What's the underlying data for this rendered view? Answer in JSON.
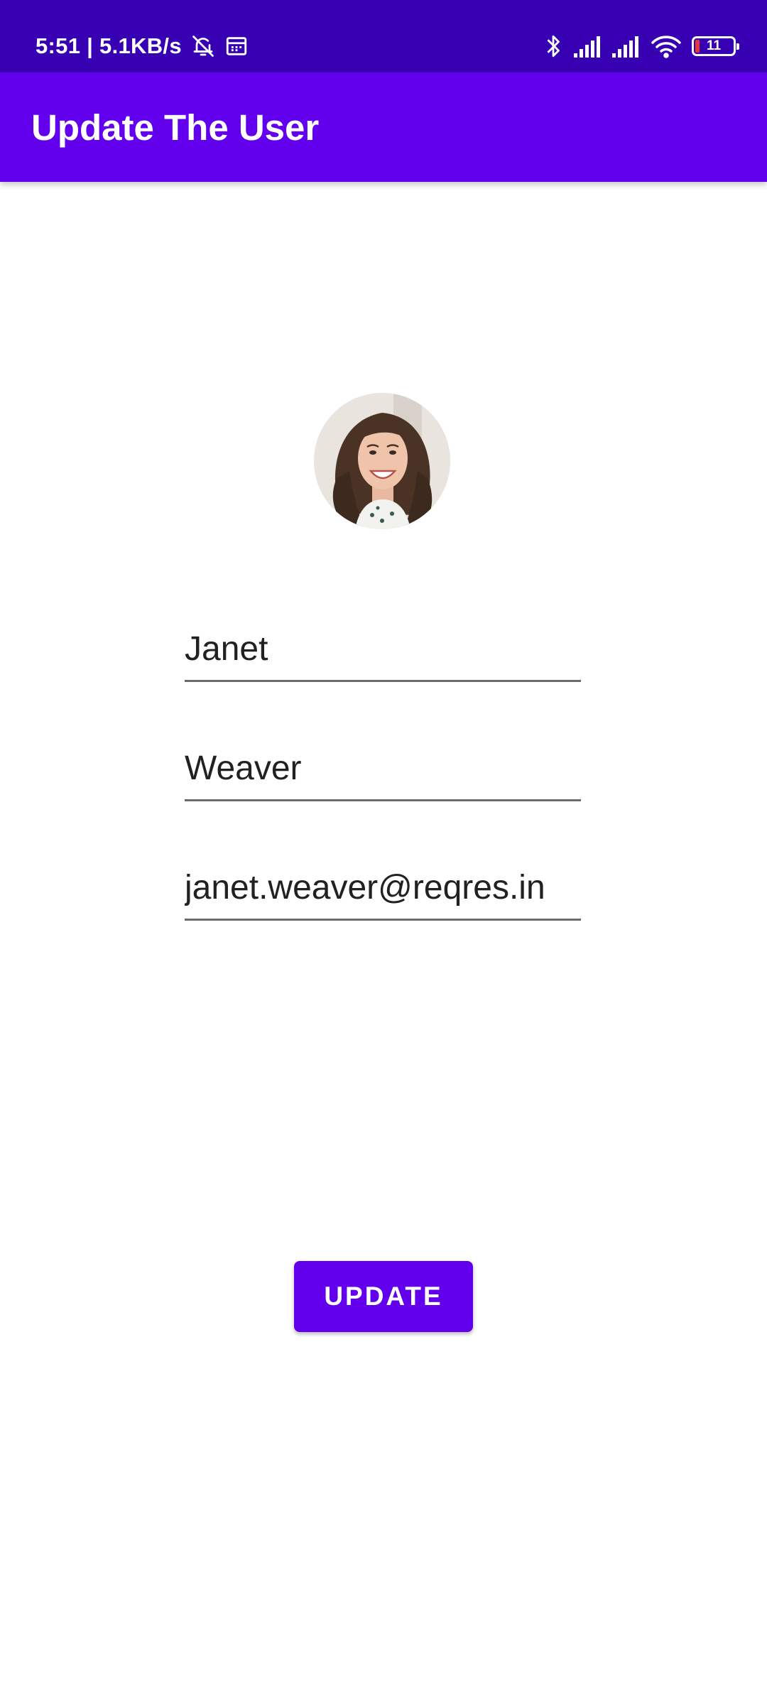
{
  "status_bar": {
    "time_and_speed": "5:51 | 5.1KB/s",
    "battery_level": "11",
    "icons": [
      "alarm-off-icon",
      "calendar-icon",
      "bluetooth-icon",
      "signal-icon",
      "signal-icon",
      "wifi-icon",
      "battery-icon"
    ]
  },
  "app_bar": {
    "title": "Update The User",
    "color": "#6200ee"
  },
  "avatar": {
    "alt": "user-avatar-photo"
  },
  "form": {
    "first_name": "Janet",
    "last_name": "Weaver",
    "email": "janet.weaver@reqres.in"
  },
  "actions": {
    "update_label": "UPDATE"
  },
  "colors": {
    "status_bar": "#3700b3",
    "primary": "#6200ee",
    "underline": "#6b6b6b"
  }
}
